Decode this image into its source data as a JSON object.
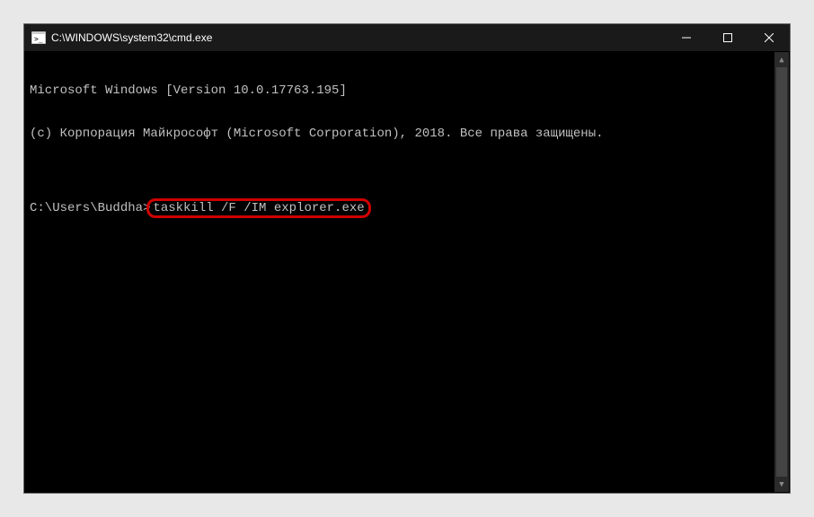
{
  "titlebar": {
    "title": "C:\\WINDOWS\\system32\\cmd.exe"
  },
  "console": {
    "line1": "Microsoft Windows [Version 10.0.17763.195]",
    "line2": "(c) Корпорация Майкрософт (Microsoft Corporation), 2018. Все права защищены.",
    "blank": "",
    "prompt": "C:\\Users\\Buddha>",
    "command": "taskkill /F /IM explorer.exe"
  },
  "scrollbar": {
    "up": "▲",
    "down": "▼"
  }
}
